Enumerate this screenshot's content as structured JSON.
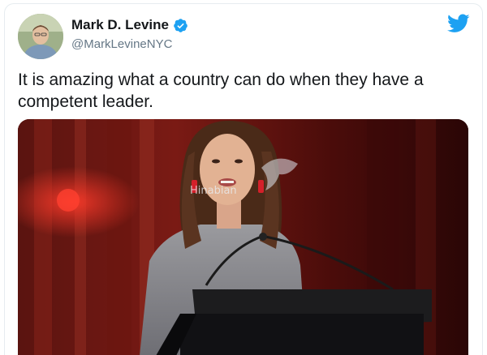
{
  "tweet": {
    "author": {
      "display_name": "Mark D. Levine",
      "handle": "@MarkLevineNYC",
      "verified": true,
      "avatar_icon": "user-avatar"
    },
    "text": "It is amazing what a country can do when they have a competent leader.",
    "media": {
      "type": "photo",
      "watermark": "Hinabian"
    },
    "brand_icon": "twitter-bird-icon"
  },
  "colors": {
    "twitter_blue": "#1da1f2",
    "text_primary": "#14171a",
    "text_secondary": "#657786"
  }
}
